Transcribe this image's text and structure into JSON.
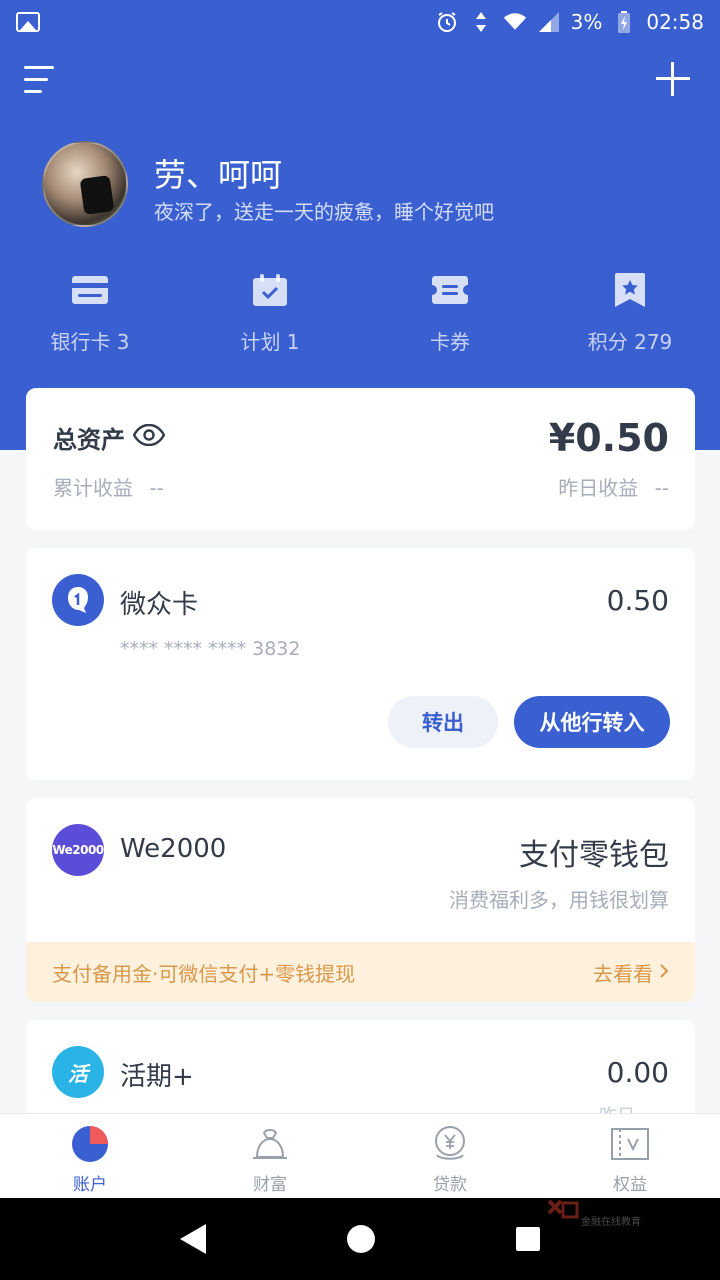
{
  "status_bar": {
    "battery": "3%",
    "time": "02:58"
  },
  "profile": {
    "name": "劳、呵呵",
    "greeting": "夜深了，送走一天的疲惫，睡个好觉吧"
  },
  "quick_links": [
    {
      "label": "银行卡 3",
      "icon": "bank-card-icon"
    },
    {
      "label": "计划 1",
      "icon": "calendar-check-icon"
    },
    {
      "label": "卡券",
      "icon": "ticket-icon"
    },
    {
      "label": "积分 279",
      "icon": "bookmark-star-icon"
    }
  ],
  "assets": {
    "title": "总资产",
    "amount": "¥0.50",
    "cumulative_label": "累计收益",
    "cumulative_value": "--",
    "yesterday_label": "昨日收益",
    "yesterday_value": "--"
  },
  "weizhong_card": {
    "name": "微众卡",
    "amount": "0.50",
    "card_number": "**** **** **** 3832",
    "transfer_out": "转出",
    "transfer_in": "从他行转入"
  },
  "we2000": {
    "logo_text": "We2000",
    "name": "We2000",
    "title": "支付零钱包",
    "subtitle": "消费福利多，用钱很划算",
    "promo_text": "支付备用金·可微信支付+零钱提现",
    "promo_link": "去看看"
  },
  "huoqi": {
    "logo_text": "活",
    "name": "活期+",
    "amount": "0.00",
    "sub": "昨日"
  },
  "tabs": [
    {
      "label": "账户",
      "icon": "pie-chart-icon",
      "active": true
    },
    {
      "label": "财富",
      "icon": "money-bag-icon",
      "active": false
    },
    {
      "label": "贷款",
      "icon": "yen-coin-icon",
      "active": false
    },
    {
      "label": "权益",
      "icon": "voucher-icon",
      "active": false
    }
  ],
  "watermark": {
    "text": "金融在线教育"
  },
  "colors": {
    "primary": "#3a5fd0",
    "promo_bg": "#fdf0dd",
    "promo_text": "#d9984a"
  }
}
